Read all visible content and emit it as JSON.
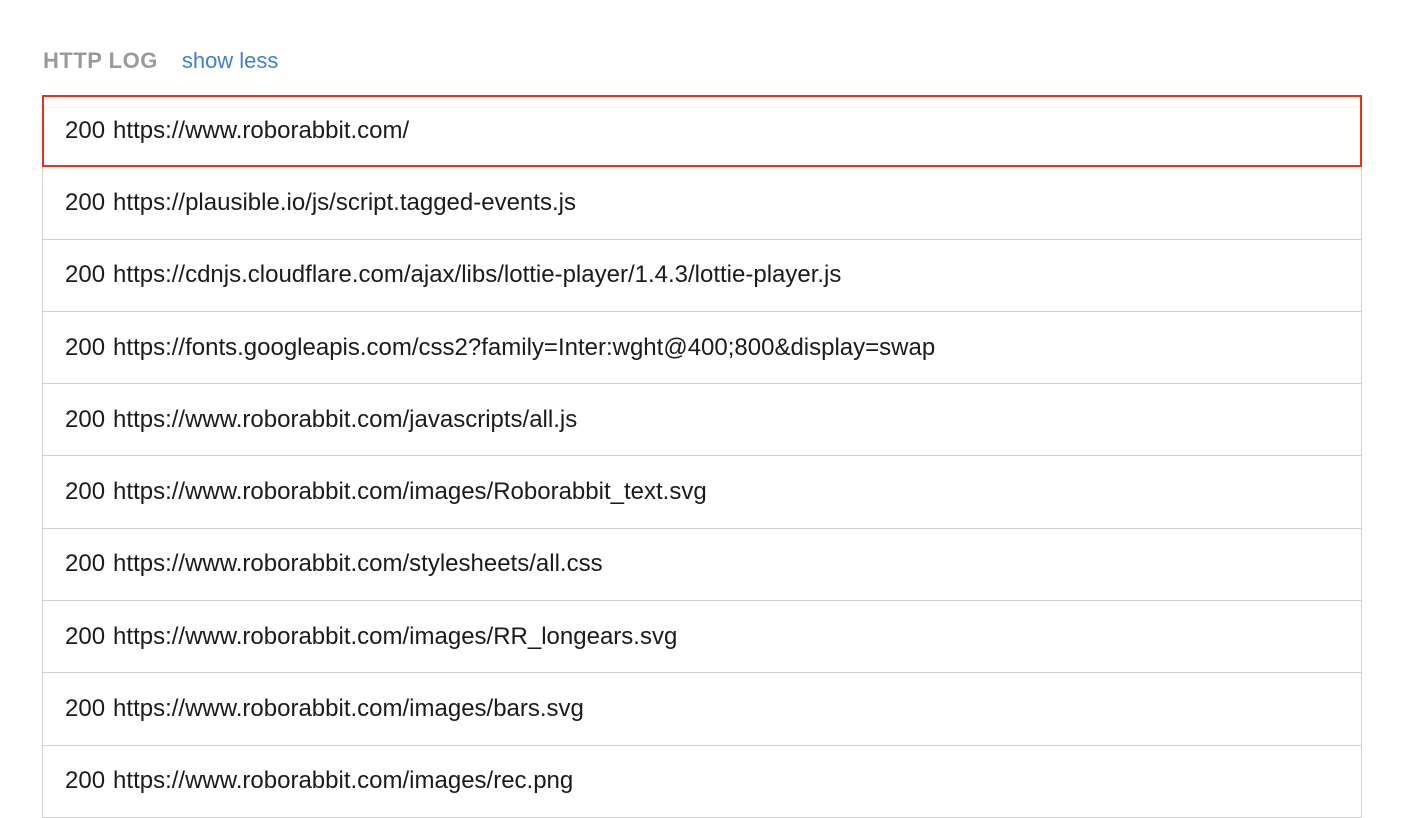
{
  "header": {
    "title": "HTTP LOG",
    "toggle_label": "show less"
  },
  "colors": {
    "title": "#9a9a9a",
    "link": "#3d7fd9",
    "selected_border": "#e8321b",
    "row_border": "#d0d0d0"
  },
  "log": {
    "entries": [
      {
        "status": "200",
        "url": "https://www.roborabbit.com/",
        "selected": true
      },
      {
        "status": "200",
        "url": "https://plausible.io/js/script.tagged-events.js",
        "selected": false
      },
      {
        "status": "200",
        "url": "https://cdnjs.cloudflare.com/ajax/libs/lottie-player/1.4.3/lottie-player.js",
        "selected": false
      },
      {
        "status": "200",
        "url": "https://fonts.googleapis.com/css2?family=Inter:wght@400;800&display=swap",
        "selected": false
      },
      {
        "status": "200",
        "url": "https://www.roborabbit.com/javascripts/all.js",
        "selected": false
      },
      {
        "status": "200",
        "url": "https://www.roborabbit.com/images/Roborabbit_text.svg",
        "selected": false
      },
      {
        "status": "200",
        "url": "https://www.roborabbit.com/stylesheets/all.css",
        "selected": false
      },
      {
        "status": "200",
        "url": "https://www.roborabbit.com/images/RR_longears.svg",
        "selected": false
      },
      {
        "status": "200",
        "url": "https://www.roborabbit.com/images/bars.svg",
        "selected": false
      },
      {
        "status": "200",
        "url": "https://www.roborabbit.com/images/rec.png",
        "selected": false
      }
    ]
  }
}
